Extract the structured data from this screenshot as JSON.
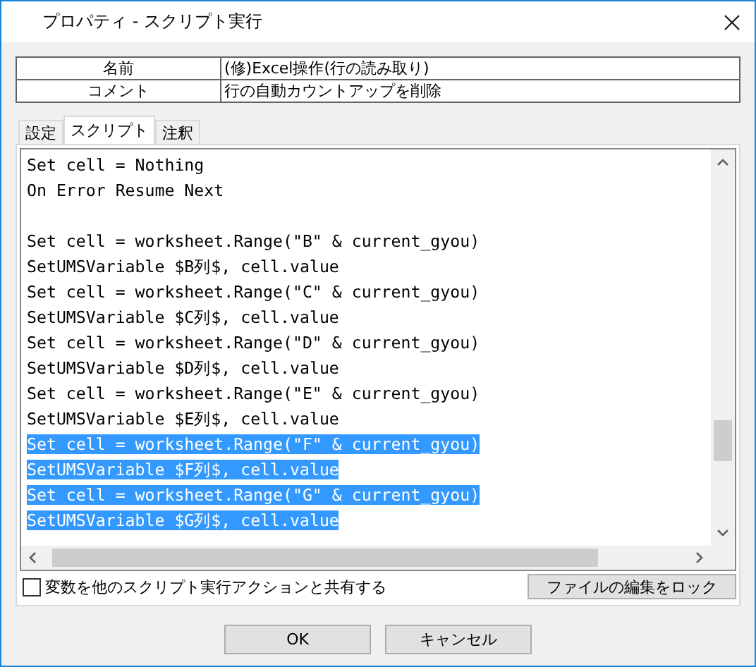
{
  "window": {
    "title": "プロパティ - スクリプト実行"
  },
  "properties": [
    {
      "label": "名前",
      "value": "(修)Excel操作(行の読み取り)"
    },
    {
      "label": "コメント",
      "value": "行の自動カウントアップを削除"
    }
  ],
  "tabs": [
    {
      "label": "設定",
      "selected": false
    },
    {
      "label": "スクリプト",
      "selected": true
    },
    {
      "label": "注釈",
      "selected": false
    }
  ],
  "script": {
    "paragraphs": [
      {
        "lines": [
          {
            "text": "Set cell = Nothing",
            "selected": false
          },
          {
            "text": "On Error Resume Next",
            "selected": false
          }
        ]
      },
      {
        "lines": [
          {
            "text": "Set cell = worksheet.Range(\"B\" & current_gyou)",
            "selected": false
          },
          {
            "text": "SetUMSVariable $B列$, cell.value",
            "selected": false
          },
          {
            "text": "Set cell = worksheet.Range(\"C\" & current_gyou)",
            "selected": false
          },
          {
            "text": "SetUMSVariable $C列$, cell.value",
            "selected": false
          },
          {
            "text": "Set cell = worksheet.Range(\"D\" & current_gyou)",
            "selected": false
          },
          {
            "text": "SetUMSVariable $D列$, cell.value",
            "selected": false
          },
          {
            "text": "Set cell = worksheet.Range(\"E\" & current_gyou)",
            "selected": false
          },
          {
            "text": "SetUMSVariable $E列$, cell.value",
            "selected": false
          },
          {
            "text": "Set cell = worksheet.Range(\"F\" & current_gyou)",
            "selected": true
          },
          {
            "text": "SetUMSVariable $F列$, cell.value",
            "selected": true
          },
          {
            "text": "Set cell = worksheet.Range(\"G\" & current_gyou)",
            "selected": true
          },
          {
            "text": "SetUMSVariable $G列$, cell.value",
            "selected": true
          }
        ]
      }
    ]
  },
  "share_checkbox": {
    "label": "変数を他のスクリプト実行アクションと共有する",
    "checked": false
  },
  "lock_button": "ファイルの編集をロック",
  "buttons": [
    "OK",
    "キャンセル"
  ]
}
